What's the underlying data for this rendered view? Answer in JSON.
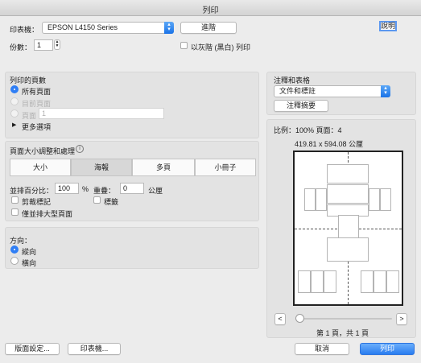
{
  "window": {
    "title": "列印"
  },
  "printer": {
    "label": "印表機：",
    "value": "EPSON L4150 Series",
    "advanced_button": "進階",
    "help_button": "說明"
  },
  "copies": {
    "label": "份數：",
    "value": "1",
    "grayscale_label": "以灰階 (黑白) 列印"
  },
  "pages": {
    "title": "列印的頁數",
    "all_label": "所有頁面",
    "current_label": "目前頁面",
    "range_label": "頁面",
    "range_placeholder": "1",
    "more_options": "更多選項"
  },
  "sizing": {
    "title": "頁面大小調整和處理",
    "info_icon": "i",
    "tabs": [
      {
        "label": "大小",
        "selected": false
      },
      {
        "label": "海報",
        "selected": true
      },
      {
        "label": "多頁",
        "selected": false
      },
      {
        "label": "小冊子",
        "selected": false
      }
    ],
    "tile_scale_label": "並排百分比：",
    "tile_scale_value": "100",
    "percent_sign": "%",
    "overlap_label": "重疊：",
    "overlap_value": "0",
    "overlap_unit": "公厘",
    "cut_marks_label": "剪裁標記",
    "labels_label": "標籤",
    "tile_large_only_label": "僅並排大型頁面"
  },
  "orientation": {
    "title": "方向：",
    "portrait_label": "縱向",
    "landscape_label": "橫向"
  },
  "annotations": {
    "title": "注釋和表格",
    "value": "文件和標註",
    "summary_button": "注釋摘要"
  },
  "preview": {
    "scale_text": "比例：100%  頁面：4",
    "dimensions_text": "419.81 x 594.08 公厘",
    "prev_button": "<",
    "next_button": ">",
    "page_indicator": "第 1 頁，共 1 頁"
  },
  "footer": {
    "page_setup_button": "版面設定...",
    "printer_button": "印表機...",
    "cancel_button": "取消",
    "print_button": "列印"
  },
  "colors": {
    "accent": "#2f7ef5",
    "panel": "#e3e3e3",
    "background": "#ececec"
  }
}
